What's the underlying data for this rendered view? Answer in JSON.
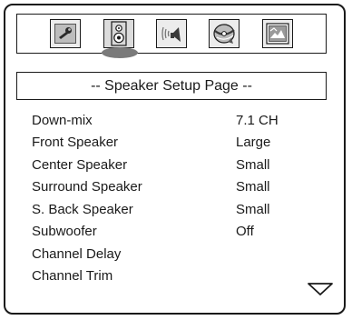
{
  "toolbar": {
    "icons": [
      {
        "name": "general-setup",
        "icon": "wrench-icon"
      },
      {
        "name": "speaker-setup",
        "icon": "speaker-icon",
        "selected": true
      },
      {
        "name": "audio-setup",
        "icon": "audio-wave-icon"
      },
      {
        "name": "video-setup",
        "icon": "disc-icon"
      },
      {
        "name": "preference-setup",
        "icon": "picture-icon"
      }
    ]
  },
  "page": {
    "title": "-- Speaker Setup Page --"
  },
  "settings": [
    {
      "label": "Down-mix",
      "value": "7.1 CH"
    },
    {
      "label": "Front Speaker",
      "value": "Large"
    },
    {
      "label": "Center Speaker",
      "value": "Small"
    },
    {
      "label": "Surround Speaker",
      "value": "Small"
    },
    {
      "label": "S. Back Speaker",
      "value": "Small"
    },
    {
      "label": "Subwoofer",
      "value": "Off"
    },
    {
      "label": "Channel Delay",
      "value": ""
    },
    {
      "label": "Channel Trim",
      "value": ""
    }
  ],
  "colors": {
    "border": "#1a1a1a",
    "icon_fill": "#ececec",
    "selection_disc": "#7a7a7a"
  }
}
